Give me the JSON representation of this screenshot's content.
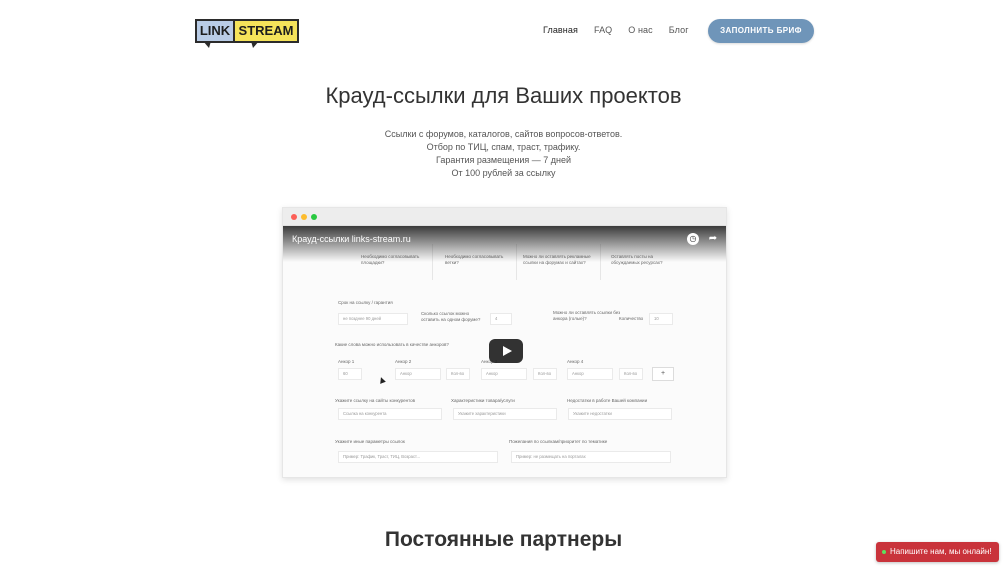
{
  "logo": {
    "part1": "LINK",
    "part2": "STREAM",
    "color1": "#b9cce6",
    "color2": "#f5e35a"
  },
  "nav": {
    "items": [
      {
        "label": "Главная"
      },
      {
        "label": "FAQ"
      },
      {
        "label": "О нас"
      },
      {
        "label": "Блог"
      }
    ],
    "cta": "ЗАПОЛНИТЬ БРИФ",
    "cta_color": "#6f95b9"
  },
  "hero": {
    "title": "Крауд-ссылки для Ваших проектов",
    "lines": [
      "Ссылки с форумов, каталогов, сайтов вопросов-ответов.",
      "Отбор по ТИЦ, спам, траст, трафику.",
      "Гарантия размещения — 7 дней",
      "От 100 рублей за ссылку"
    ]
  },
  "video": {
    "title": "Крауд-ссылки links-stream.ru",
    "icons": [
      "clock-icon",
      "share-icon",
      "play-icon"
    ],
    "form": {
      "cards": [
        "Необходимо согласовывать площадки?",
        "Необходимо согласовывать ветки?",
        "Можно ли оставлять рекламные ссылки на форумах и сайтах?",
        "Оставлять посты на обсуждаемых ресурсах?"
      ],
      "section1": "Срок на ссылку / гарантия",
      "field_period": "не позднее 90 дней",
      "label_count": "Сколько ссылок можно оставить на одном форуме?",
      "field_count": "4",
      "label_unanchor": "Можно ли оставлять ссылки без анкора (голые)?",
      "label_quantity": "Количество",
      "field_quantity": "10",
      "section2": "Какие слова можно использовать в качестве анкоров?",
      "col_label1": "Анкор 1",
      "col_label2": "Анкор 2",
      "col_label3": "Анкор 3",
      "col_label4": "Анкор 4",
      "anchor_value": "60",
      "anchor_ph": "Анкор",
      "weight_ph": "Кол-во",
      "plus": "+",
      "label_competitors": "Укажите ссылку на сайты конкурентов",
      "label_character": "Характеристики товара/услуги",
      "label_features": "Недостатки в работе Вашей компании",
      "ph_competitors": "Ссылка на конкурента",
      "ph_character": "Укажите характеристики",
      "ph_features": "Укажите недостатки",
      "label_params": "Укажите иные параметры ссылок",
      "label_wishes": "Пожелания по ссылкам/приоритет по тематике",
      "ph_params": "Пример: Трафик, Траст, ТИЦ, Возраст...",
      "ph_wishes": "Пример: не размещать на порталах"
    }
  },
  "partners": {
    "title": "Постоянные партнеры"
  },
  "chat": {
    "label": "Напишите нам, мы онлайн!",
    "color": "#c9333b"
  }
}
